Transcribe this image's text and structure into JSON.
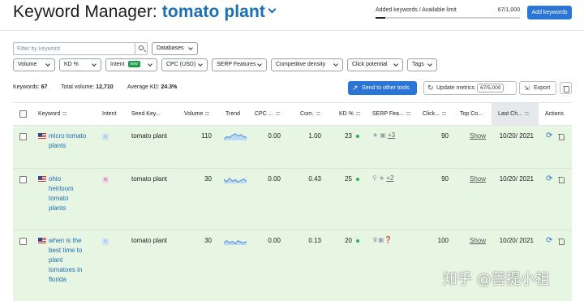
{
  "header": {
    "title": "Keyword Manager:",
    "list_name": "tomato plant",
    "limit_label": "Added keywords / Available limit",
    "limit_value": "67/1,000",
    "limit_fraction": 0.067,
    "add_button": "Add keywords"
  },
  "filters": {
    "search_placeholder": "Filter by keyword",
    "databases": "Databases",
    "volume": "Volume",
    "kd": "KD %",
    "intent": "Intent",
    "intent_badge": "new",
    "cpc": "CPC (USD)",
    "serp_features": "SERP Features",
    "competitive_density": "Competitive density",
    "click_potential": "Click potential",
    "tags": "Tags"
  },
  "stats": {
    "keywords_label": "Keywords:",
    "keywords_value": "67",
    "volume_label": "Total volume:",
    "volume_value": "12,710",
    "kd_label": "Average KD:",
    "kd_value": "24.3%"
  },
  "actions": {
    "send": "Send to other tools",
    "update": "Update metrics",
    "update_count": "67/5,000",
    "export": "Export"
  },
  "columns": {
    "keyword": "Keyword",
    "intent": "Intent",
    "seed": "Seed Key...",
    "volume": "Volume",
    "trend": "Trend",
    "cpc": "CPC ...",
    "com": "Com.",
    "kd": "KD %",
    "serp": "SERP Fea...",
    "click": "Click...",
    "top": "Top Co...",
    "last": "Last Ch...",
    "actions": "Actions"
  },
  "rows": [
    {
      "keyword": "micro tomato plants",
      "intent": "I",
      "intent_color": "#cfe3f8",
      "seed": "tomato plant",
      "volume": "110",
      "trend": [
        0.2,
        0.5,
        0.4,
        0.7,
        0.9,
        0.6,
        0.8,
        0.5,
        0.4
      ],
      "cpc": "0.00",
      "com": "1.00",
      "kd": "23",
      "serp_icons": [
        "star-icon",
        "video-icon"
      ],
      "serp_more": "+3",
      "click": "90",
      "top": "Show",
      "last": "10/20/ 2021"
    },
    {
      "keyword": "ohio heirloom tomato plants",
      "intent": "N",
      "intent_color": "#f4d6e6",
      "seed": "tomato plant",
      "volume": "30",
      "trend": [
        0.6,
        0.2,
        0.7,
        0.3,
        0.5,
        0.2,
        0.4,
        0.6,
        0.3
      ],
      "cpc": "0.00",
      "com": "0.43",
      "kd": "25",
      "serp_icons": [
        "pin-icon",
        "star-icon"
      ],
      "serp_more": "+2",
      "click": "90",
      "top": "Show",
      "last": "10/20/ 2021"
    },
    {
      "keyword": "when is the best time to plant tomatoes in florida",
      "intent": "I",
      "intent_color": "#cfe3f8",
      "seed": "tomato plant",
      "volume": "30",
      "trend": [
        0.3,
        0.6,
        0.3,
        0.5,
        0.2,
        0.6,
        0.4,
        0.3,
        0.5
      ],
      "cpc": "0.00",
      "com": "0.13",
      "kd": "20",
      "serp_icons": [
        "crown-icon",
        "video-icon",
        "faq-icon"
      ],
      "serp_more": "",
      "click": "100",
      "top": "Show",
      "last": "10/20/ 2021"
    }
  ],
  "watermark": "知乎 @菩提小祖"
}
